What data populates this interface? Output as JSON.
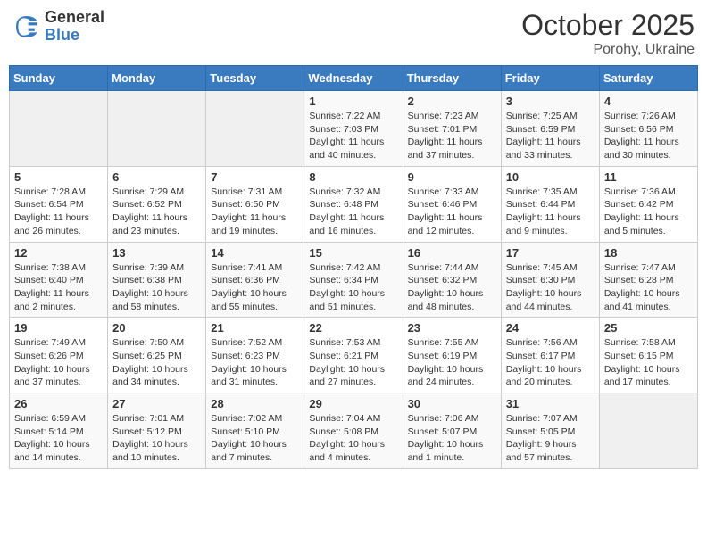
{
  "header": {
    "logo_general": "General",
    "logo_blue": "Blue",
    "month": "October 2025",
    "location": "Porohy, Ukraine"
  },
  "weekdays": [
    "Sunday",
    "Monday",
    "Tuesday",
    "Wednesday",
    "Thursday",
    "Friday",
    "Saturday"
  ],
  "weeks": [
    [
      {
        "day": "",
        "info": ""
      },
      {
        "day": "",
        "info": ""
      },
      {
        "day": "",
        "info": ""
      },
      {
        "day": "1",
        "info": "Sunrise: 7:22 AM\nSunset: 7:03 PM\nDaylight: 11 hours\nand 40 minutes."
      },
      {
        "day": "2",
        "info": "Sunrise: 7:23 AM\nSunset: 7:01 PM\nDaylight: 11 hours\nand 37 minutes."
      },
      {
        "day": "3",
        "info": "Sunrise: 7:25 AM\nSunset: 6:59 PM\nDaylight: 11 hours\nand 33 minutes."
      },
      {
        "day": "4",
        "info": "Sunrise: 7:26 AM\nSunset: 6:56 PM\nDaylight: 11 hours\nand 30 minutes."
      }
    ],
    [
      {
        "day": "5",
        "info": "Sunrise: 7:28 AM\nSunset: 6:54 PM\nDaylight: 11 hours\nand 26 minutes."
      },
      {
        "day": "6",
        "info": "Sunrise: 7:29 AM\nSunset: 6:52 PM\nDaylight: 11 hours\nand 23 minutes."
      },
      {
        "day": "7",
        "info": "Sunrise: 7:31 AM\nSunset: 6:50 PM\nDaylight: 11 hours\nand 19 minutes."
      },
      {
        "day": "8",
        "info": "Sunrise: 7:32 AM\nSunset: 6:48 PM\nDaylight: 11 hours\nand 16 minutes."
      },
      {
        "day": "9",
        "info": "Sunrise: 7:33 AM\nSunset: 6:46 PM\nDaylight: 11 hours\nand 12 minutes."
      },
      {
        "day": "10",
        "info": "Sunrise: 7:35 AM\nSunset: 6:44 PM\nDaylight: 11 hours\nand 9 minutes."
      },
      {
        "day": "11",
        "info": "Sunrise: 7:36 AM\nSunset: 6:42 PM\nDaylight: 11 hours\nand 5 minutes."
      }
    ],
    [
      {
        "day": "12",
        "info": "Sunrise: 7:38 AM\nSunset: 6:40 PM\nDaylight: 11 hours\nand 2 minutes."
      },
      {
        "day": "13",
        "info": "Sunrise: 7:39 AM\nSunset: 6:38 PM\nDaylight: 10 hours\nand 58 minutes."
      },
      {
        "day": "14",
        "info": "Sunrise: 7:41 AM\nSunset: 6:36 PM\nDaylight: 10 hours\nand 55 minutes."
      },
      {
        "day": "15",
        "info": "Sunrise: 7:42 AM\nSunset: 6:34 PM\nDaylight: 10 hours\nand 51 minutes."
      },
      {
        "day": "16",
        "info": "Sunrise: 7:44 AM\nSunset: 6:32 PM\nDaylight: 10 hours\nand 48 minutes."
      },
      {
        "day": "17",
        "info": "Sunrise: 7:45 AM\nSunset: 6:30 PM\nDaylight: 10 hours\nand 44 minutes."
      },
      {
        "day": "18",
        "info": "Sunrise: 7:47 AM\nSunset: 6:28 PM\nDaylight: 10 hours\nand 41 minutes."
      }
    ],
    [
      {
        "day": "19",
        "info": "Sunrise: 7:49 AM\nSunset: 6:26 PM\nDaylight: 10 hours\nand 37 minutes."
      },
      {
        "day": "20",
        "info": "Sunrise: 7:50 AM\nSunset: 6:25 PM\nDaylight: 10 hours\nand 34 minutes."
      },
      {
        "day": "21",
        "info": "Sunrise: 7:52 AM\nSunset: 6:23 PM\nDaylight: 10 hours\nand 31 minutes."
      },
      {
        "day": "22",
        "info": "Sunrise: 7:53 AM\nSunset: 6:21 PM\nDaylight: 10 hours\nand 27 minutes."
      },
      {
        "day": "23",
        "info": "Sunrise: 7:55 AM\nSunset: 6:19 PM\nDaylight: 10 hours\nand 24 minutes."
      },
      {
        "day": "24",
        "info": "Sunrise: 7:56 AM\nSunset: 6:17 PM\nDaylight: 10 hours\nand 20 minutes."
      },
      {
        "day": "25",
        "info": "Sunrise: 7:58 AM\nSunset: 6:15 PM\nDaylight: 10 hours\nand 17 minutes."
      }
    ],
    [
      {
        "day": "26",
        "info": "Sunrise: 6:59 AM\nSunset: 5:14 PM\nDaylight: 10 hours\nand 14 minutes."
      },
      {
        "day": "27",
        "info": "Sunrise: 7:01 AM\nSunset: 5:12 PM\nDaylight: 10 hours\nand 10 minutes."
      },
      {
        "day": "28",
        "info": "Sunrise: 7:02 AM\nSunset: 5:10 PM\nDaylight: 10 hours\nand 7 minutes."
      },
      {
        "day": "29",
        "info": "Sunrise: 7:04 AM\nSunset: 5:08 PM\nDaylight: 10 hours\nand 4 minutes."
      },
      {
        "day": "30",
        "info": "Sunrise: 7:06 AM\nSunset: 5:07 PM\nDaylight: 10 hours\nand 1 minute."
      },
      {
        "day": "31",
        "info": "Sunrise: 7:07 AM\nSunset: 5:05 PM\nDaylight: 9 hours\nand 57 minutes."
      },
      {
        "day": "",
        "info": ""
      }
    ]
  ]
}
